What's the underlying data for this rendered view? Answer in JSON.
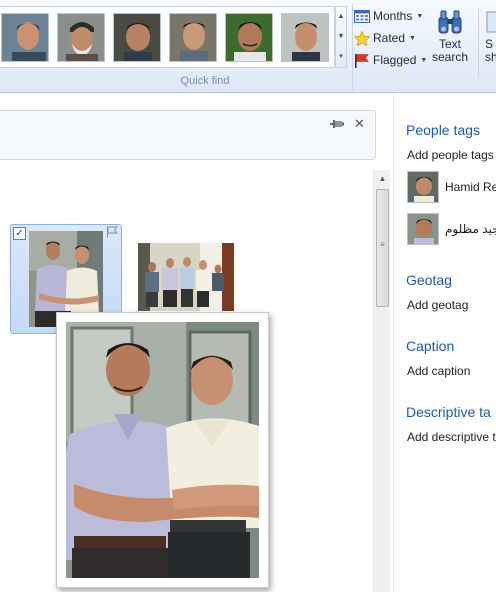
{
  "ribbon": {
    "group_label": "Quick find",
    "buttons": {
      "months": "Months",
      "rated": "Rated",
      "flagged": "Flagged",
      "text_search_line1": "Text",
      "text_search_line2": "search",
      "cut_line1": "S",
      "cut_line2": "sh"
    },
    "icons": [
      "calendar-icon",
      "star-icon",
      "flag-icon",
      "binoculars-icon",
      "chevron-down-icon"
    ]
  },
  "details_pane": {
    "people_tags_header": "People tags",
    "add_people_tags": "Add people tags",
    "people": [
      {
        "name": "Hamid Re"
      },
      {
        "name": "مجید مظلوم"
      }
    ],
    "geotag_header": "Geotag",
    "add_geotag": "Add geotag",
    "caption_header": "Caption",
    "add_caption": "Add caption",
    "descriptive_header": "Descriptive ta",
    "add_descriptive": "Add descriptive t"
  },
  "colors": {
    "accent": "#1e5aa8",
    "selection": "#c4d9f6",
    "ribbon_bg": "#dde8f5"
  }
}
